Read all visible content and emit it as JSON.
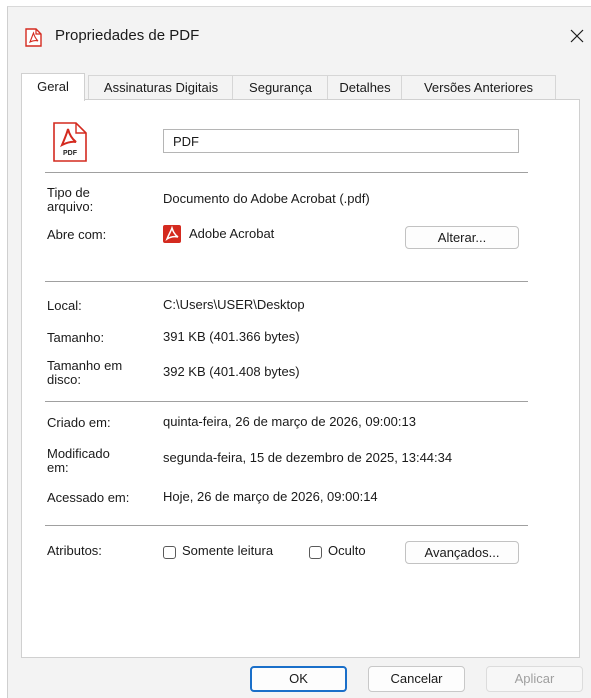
{
  "window": {
    "title": "Propriedades de PDF"
  },
  "tabs": [
    {
      "label": "Geral"
    },
    {
      "label": "Assinaturas Digitais"
    },
    {
      "label": "Segurança"
    },
    {
      "label": "Detalhes"
    },
    {
      "label": "Versões Anteriores"
    }
  ],
  "file": {
    "name": "PDF",
    "icon": "pdf-file-icon",
    "icon_caption": "PDF"
  },
  "info": {
    "type_label_line1": "Tipo de",
    "type_label_line2": "arquivo:",
    "type_value": "Documento do Adobe Acrobat (.pdf)",
    "opens_label": "Abre com:",
    "opens_value": "Adobe Acrobat",
    "change_button": "Alterar...",
    "location_label": "Local:",
    "location_value": "C:\\Users\\USER\\Desktop",
    "size_label": "Tamanho:",
    "size_value": "391 KB (401.366 bytes)",
    "disk_label_line1": "Tamanho em",
    "disk_label_line2": "disco:",
    "disk_value": "392 KB (401.408 bytes)",
    "created_label": "Criado em:",
    "created_value": "quinta-feira, 26 de março de 2026, 09:00:13",
    "modified_label_line1": "Modificado",
    "modified_label_line2": "em:",
    "modified_value": "segunda-feira, 15 de dezembro de 2025, 13:44:34",
    "accessed_label": "Acessado em:",
    "accessed_value": "Hoje, 26 de março de 2026, 09:00:14",
    "attributes_label": "Atributos:",
    "readonly_label": "Somente leitura",
    "readonly_checked": false,
    "hidden_label": "Oculto",
    "hidden_checked": false,
    "advanced_button": "Avançados..."
  },
  "footer": {
    "ok": "OK",
    "cancel": "Cancelar",
    "apply": "Aplicar"
  },
  "colors": {
    "accent": "#1a6fc9",
    "pdf_red": "#d42a1f"
  }
}
